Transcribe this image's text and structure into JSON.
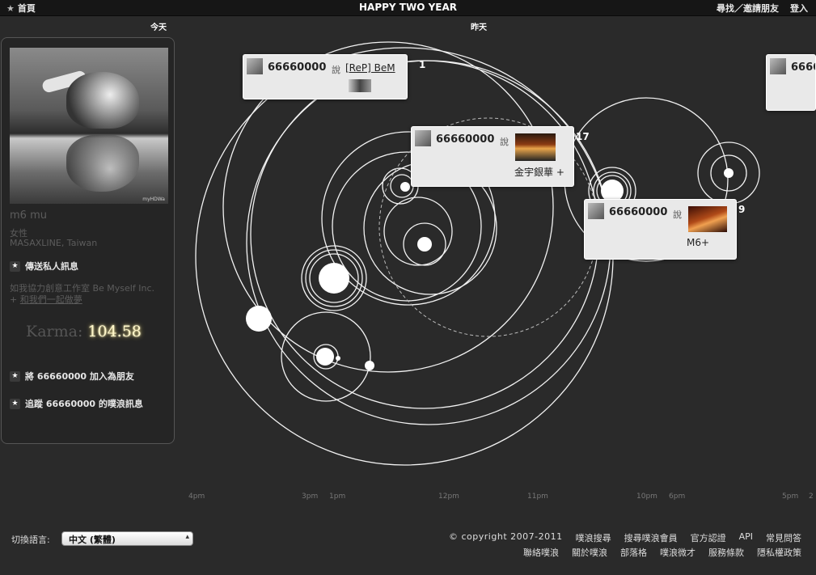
{
  "topbar": {
    "home_label": "首頁",
    "title": "HAPPY TWO YEAR",
    "find_friends": "尋找／邀請朋友",
    "login": "登入"
  },
  "day_labels": {
    "today": "今天",
    "yesterday": "昨天"
  },
  "profile": {
    "display_name": "m6 mu",
    "gender": "女性",
    "location": "MASAXLINE, Taiwan",
    "avatar_watermark": "myHDWa",
    "send_private_message": "傳送私人訊息",
    "bio": "如我協力創意工作室 Be Myself Inc.",
    "bio_link_prefix": "+ ",
    "bio_link": "和我們一起做夢",
    "karma_label": "Karma:",
    "karma_value": "104.58",
    "add_friend": "將 66660000 加入為朋友",
    "follow": "追蹤 66660000 的噗浪訊息"
  },
  "plurks": [
    {
      "user": "66660000",
      "verb": "說",
      "text": "[ReP] BeM",
      "count": "1"
    },
    {
      "user": "66660000",
      "verb": "說",
      "text": "金宇銀華 +",
      "count": "17"
    },
    {
      "user": "66660000",
      "verb": "說",
      "text": "M6+",
      "count": "9"
    },
    {
      "user": "6666",
      "verb": "",
      "text": "",
      "count": ""
    }
  ],
  "time_ticks": [
    "4pm",
    "3pm",
    "1pm",
    "12pm",
    "11pm",
    "10pm",
    "6pm",
    "5pm",
    "2"
  ],
  "footer": {
    "language_label": "切換語言:",
    "language_selected": "中文 (繁體)",
    "copyright": "© copyright 2007-2011",
    "row1": [
      "噗浪搜尋",
      "搜尋噗浪會員",
      "官方認證",
      "API",
      "常見問答"
    ],
    "row2": [
      "聯絡噗浪",
      "關於噗浪",
      "部落格",
      "噗浪微才",
      "服務條款",
      "隱私權政策"
    ]
  },
  "colors": {
    "background": "#2a2a2a",
    "card": "#e9e9e9",
    "karma_glow": "#fff7c9"
  }
}
